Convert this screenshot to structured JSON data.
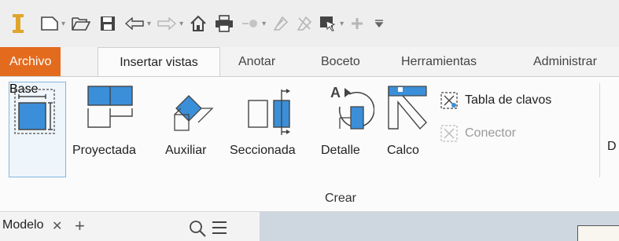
{
  "quick_access": {
    "icons": [
      "app-logo-icon",
      "new-icon",
      "open-icon",
      "save-icon",
      "undo-icon",
      "redo-icon",
      "home-icon",
      "print-icon",
      "return-icon",
      "update-icon",
      "rebuild-icon",
      "select-icon",
      "add-icon",
      "customize-icon"
    ]
  },
  "tabs": [
    {
      "label": "Archivo"
    },
    {
      "label": "Insertar vistas"
    },
    {
      "label": "Anotar"
    },
    {
      "label": "Boceto"
    },
    {
      "label": "Herramientas"
    },
    {
      "label": "Administrar"
    }
  ],
  "ribbon": {
    "buttons": [
      {
        "label": "Base"
      },
      {
        "label": "Proyectada"
      },
      {
        "label": "Auxiliar"
      },
      {
        "label": "Seccionada"
      },
      {
        "label": "Detalle"
      },
      {
        "label": "Calco"
      }
    ],
    "small_buttons": [
      {
        "label": "Tabla de clavos",
        "enabled": true
      },
      {
        "label": "Conector",
        "enabled": false
      }
    ],
    "panel_title": "Crear",
    "next_panel_partial": "D"
  },
  "browser": {
    "tab_label": "Modelo",
    "close": "✕",
    "add": "+"
  },
  "colors": {
    "file_tab": "#e36b1e",
    "icon_blue": "#3b8fd9",
    "selection_border": "#84b6e0"
  }
}
